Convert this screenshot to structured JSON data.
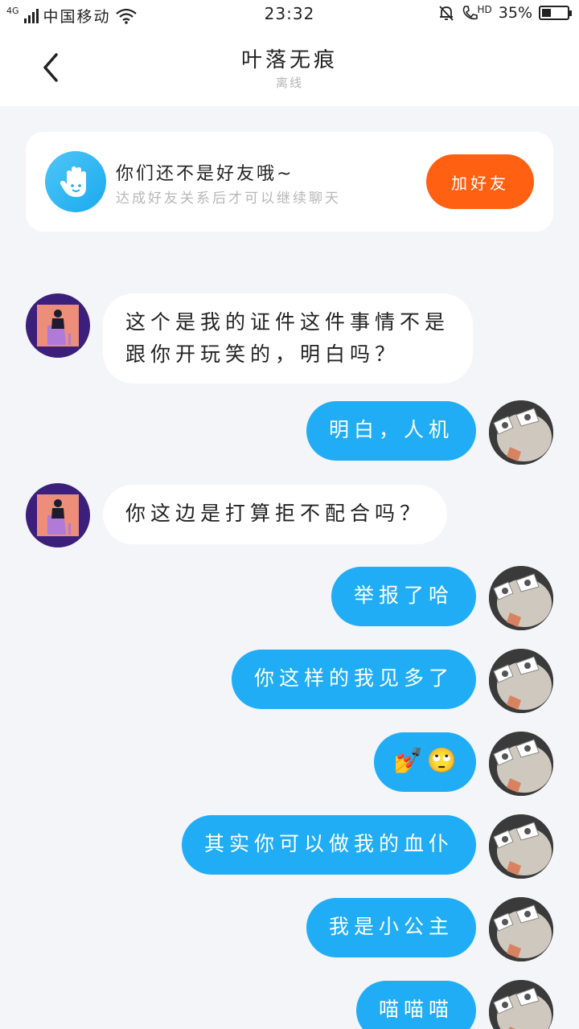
{
  "status_bar": {
    "network": "4G",
    "carrier": "中国移动",
    "time": "23:32",
    "hd_label": "HD",
    "battery_text": "35%",
    "battery_level": 0.35
  },
  "header": {
    "title": "叶落无痕",
    "subtitle": "离线"
  },
  "friend_notice": {
    "icon": "hand-icon",
    "title": "你们还不是好友哦~",
    "subtitle": "达成好友关系后才可以继续聊天",
    "button_label": "加好友",
    "button_color": "#ff6012"
  },
  "messages": [
    {
      "side": "in",
      "lines": [
        "这个是我的证件这件事情不是",
        "跟你开玩笑的，明白吗？"
      ]
    },
    {
      "side": "out",
      "text": "明白，人机"
    },
    {
      "side": "in",
      "text": "你这边是打算拒不配合吗？"
    },
    {
      "side": "out",
      "text": "举报了哈"
    },
    {
      "side": "out",
      "text": "你这样的我见多了"
    },
    {
      "side": "out",
      "emojis": [
        "💅",
        "🙄"
      ]
    },
    {
      "side": "out",
      "text": "其实你可以做我的血仆"
    },
    {
      "side": "out",
      "text": "我是小公主"
    },
    {
      "side": "out",
      "text": "喵喵喵"
    }
  ],
  "colors": {
    "out_bubble": "#20adf5",
    "in_bubble": "#ffffff",
    "background": "#f3f5f8"
  }
}
